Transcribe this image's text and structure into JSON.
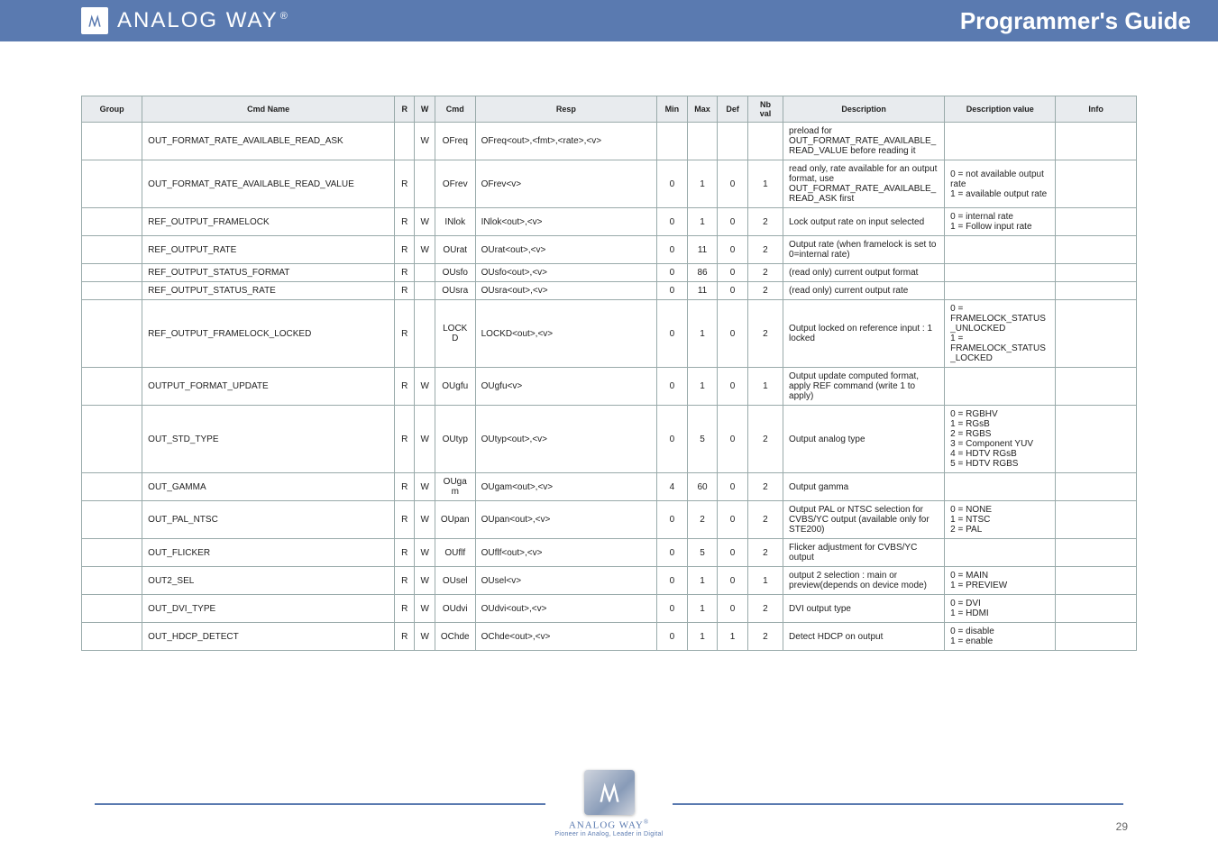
{
  "header": {
    "brand": "ANALOG WAY",
    "brand_suffix": "®",
    "title": "Programmer's Guide"
  },
  "table": {
    "headers": [
      "Group",
      "Cmd Name",
      "R",
      "W",
      "Cmd",
      "Resp",
      "Min",
      "Max",
      "Def",
      "Nb val",
      "Description",
      "Description value",
      "Info"
    ],
    "rows": [
      {
        "group": "",
        "name": "OUT_FORMAT_RATE_AVAILABLE_READ_ASK",
        "r": "",
        "w": "W",
        "cmd": "OFreq",
        "resp": "OFreq<out>,<fmt>,<rate>,<v>",
        "min": "",
        "max": "",
        "def": "",
        "nv": "",
        "desc": "preload for OUT_FORMAT_RATE_AVAILABLE_READ_VALUE before reading it",
        "descv": "",
        "info": ""
      },
      {
        "group": "",
        "name": "OUT_FORMAT_RATE_AVAILABLE_READ_VALUE",
        "r": "R",
        "w": "",
        "cmd": "OFrev",
        "resp": "OFrev<v>",
        "min": "0",
        "max": "1",
        "def": "0",
        "nv": "1",
        "desc": "read only, rate available for an output format, use OUT_FORMAT_RATE_AVAILABLE_READ_ASK first",
        "descv": "0 = not available output rate\n1 = available output rate",
        "info": ""
      },
      {
        "group": "",
        "name": "REF_OUTPUT_FRAMELOCK",
        "r": "R",
        "w": "W",
        "cmd": "INlok",
        "resp": "INlok<out>,<v>",
        "min": "0",
        "max": "1",
        "def": "0",
        "nv": "2",
        "desc": "Lock output rate on input selected",
        "descv": "0 = internal rate\n1 = Follow input rate",
        "info": ""
      },
      {
        "group": "",
        "name": "REF_OUTPUT_RATE",
        "r": "R",
        "w": "W",
        "cmd": "OUrat",
        "resp": "OUrat<out>,<v>",
        "min": "0",
        "max": "11",
        "def": "0",
        "nv": "2",
        "desc": "Output rate (when framelock is set to 0=internal rate)",
        "descv": "",
        "info": ""
      },
      {
        "group": "",
        "name": "REF_OUTPUT_STATUS_FORMAT",
        "r": "R",
        "w": "",
        "cmd": "OUsfo",
        "resp": "OUsfo<out>,<v>",
        "min": "0",
        "max": "86",
        "def": "0",
        "nv": "2",
        "desc": "(read only) current output format",
        "descv": "",
        "info": ""
      },
      {
        "group": "",
        "name": "REF_OUTPUT_STATUS_RATE",
        "r": "R",
        "w": "",
        "cmd": "OUsra",
        "resp": "OUsra<out>,<v>",
        "min": "0",
        "max": "11",
        "def": "0",
        "nv": "2",
        "desc": "(read only) current output rate",
        "descv": "",
        "info": ""
      },
      {
        "group": "",
        "name": "REF_OUTPUT_FRAMELOCK_LOCKED",
        "r": "R",
        "w": "",
        "cmd": "LOCKD",
        "resp": "LOCKD<out>,<v>",
        "min": "0",
        "max": "1",
        "def": "0",
        "nv": "2",
        "desc": "Output locked on reference input : 1 locked",
        "descv": "0 = FRAMELOCK_STATUS_UNLOCKED\n1 = FRAMELOCK_STATUS_LOCKED",
        "info": ""
      },
      {
        "group": "",
        "name": "OUTPUT_FORMAT_UPDATE",
        "r": "R",
        "w": "W",
        "cmd": "OUgfu",
        "resp": "OUgfu<v>",
        "min": "0",
        "max": "1",
        "def": "0",
        "nv": "1",
        "desc": "Output update computed format, apply REF command (write 1 to apply)",
        "descv": "",
        "info": ""
      },
      {
        "group": "",
        "name": "OUT_STD_TYPE",
        "r": "R",
        "w": "W",
        "cmd": "OUtyp",
        "resp": "OUtyp<out>,<v>",
        "min": "0",
        "max": "5",
        "def": "0",
        "nv": "2",
        "desc": "Output analog type",
        "descv": "0 = RGBHV\n1 = RGsB\n2 = RGBS\n3 = Component YUV\n4 = HDTV RGsB\n5 = HDTV RGBS",
        "info": ""
      },
      {
        "group": "",
        "name": "OUT_GAMMA",
        "r": "R",
        "w": "W",
        "cmd": "OUgam",
        "resp": "OUgam<out>,<v>",
        "min": "4",
        "max": "60",
        "def": "0",
        "nv": "2",
        "desc": "Output gamma",
        "descv": "",
        "info": ""
      },
      {
        "group": "",
        "name": "OUT_PAL_NTSC",
        "r": "R",
        "w": "W",
        "cmd": "OUpan",
        "resp": "OUpan<out>,<v>",
        "min": "0",
        "max": "2",
        "def": "0",
        "nv": "2",
        "desc": "Output PAL or NTSC selection for CVBS/YC output (available only for STE200)",
        "descv": "0 = NONE\n1 = NTSC\n2 = PAL",
        "info": ""
      },
      {
        "group": "",
        "name": "OUT_FLICKER",
        "r": "R",
        "w": "W",
        "cmd": "OUflf",
        "resp": "OUflf<out>,<v>",
        "min": "0",
        "max": "5",
        "def": "0",
        "nv": "2",
        "desc": "Flicker adjustment for CVBS/YC output",
        "descv": "",
        "info": ""
      },
      {
        "group": "",
        "name": "OUT2_SEL",
        "r": "R",
        "w": "W",
        "cmd": "OUsel",
        "resp": "OUsel<v>",
        "min": "0",
        "max": "1",
        "def": "0",
        "nv": "1",
        "desc": "output 2 selection : main or preview(depends on device mode)",
        "descv": "0 = MAIN\n1 = PREVIEW",
        "info": ""
      },
      {
        "group": "",
        "name": "OUT_DVI_TYPE",
        "r": "R",
        "w": "W",
        "cmd": "OUdvi",
        "resp": "OUdvi<out>,<v>",
        "min": "0",
        "max": "1",
        "def": "0",
        "nv": "2",
        "desc": "DVI output type",
        "descv": "0 = DVI\n1 = HDMI",
        "info": ""
      },
      {
        "group": "",
        "name": "OUT_HDCP_DETECT",
        "r": "R",
        "w": "W",
        "cmd": "OChde",
        "resp": "OChde<out>,<v>",
        "min": "0",
        "max": "1",
        "def": "1",
        "nv": "2",
        "desc": "Detect HDCP on output",
        "descv": "0 = disable\n1 = enable",
        "info": ""
      }
    ]
  },
  "footer": {
    "brand": "ANALOG WAY",
    "tagline": "Pioneer in Analog, Leader in Digital",
    "page": "29"
  }
}
